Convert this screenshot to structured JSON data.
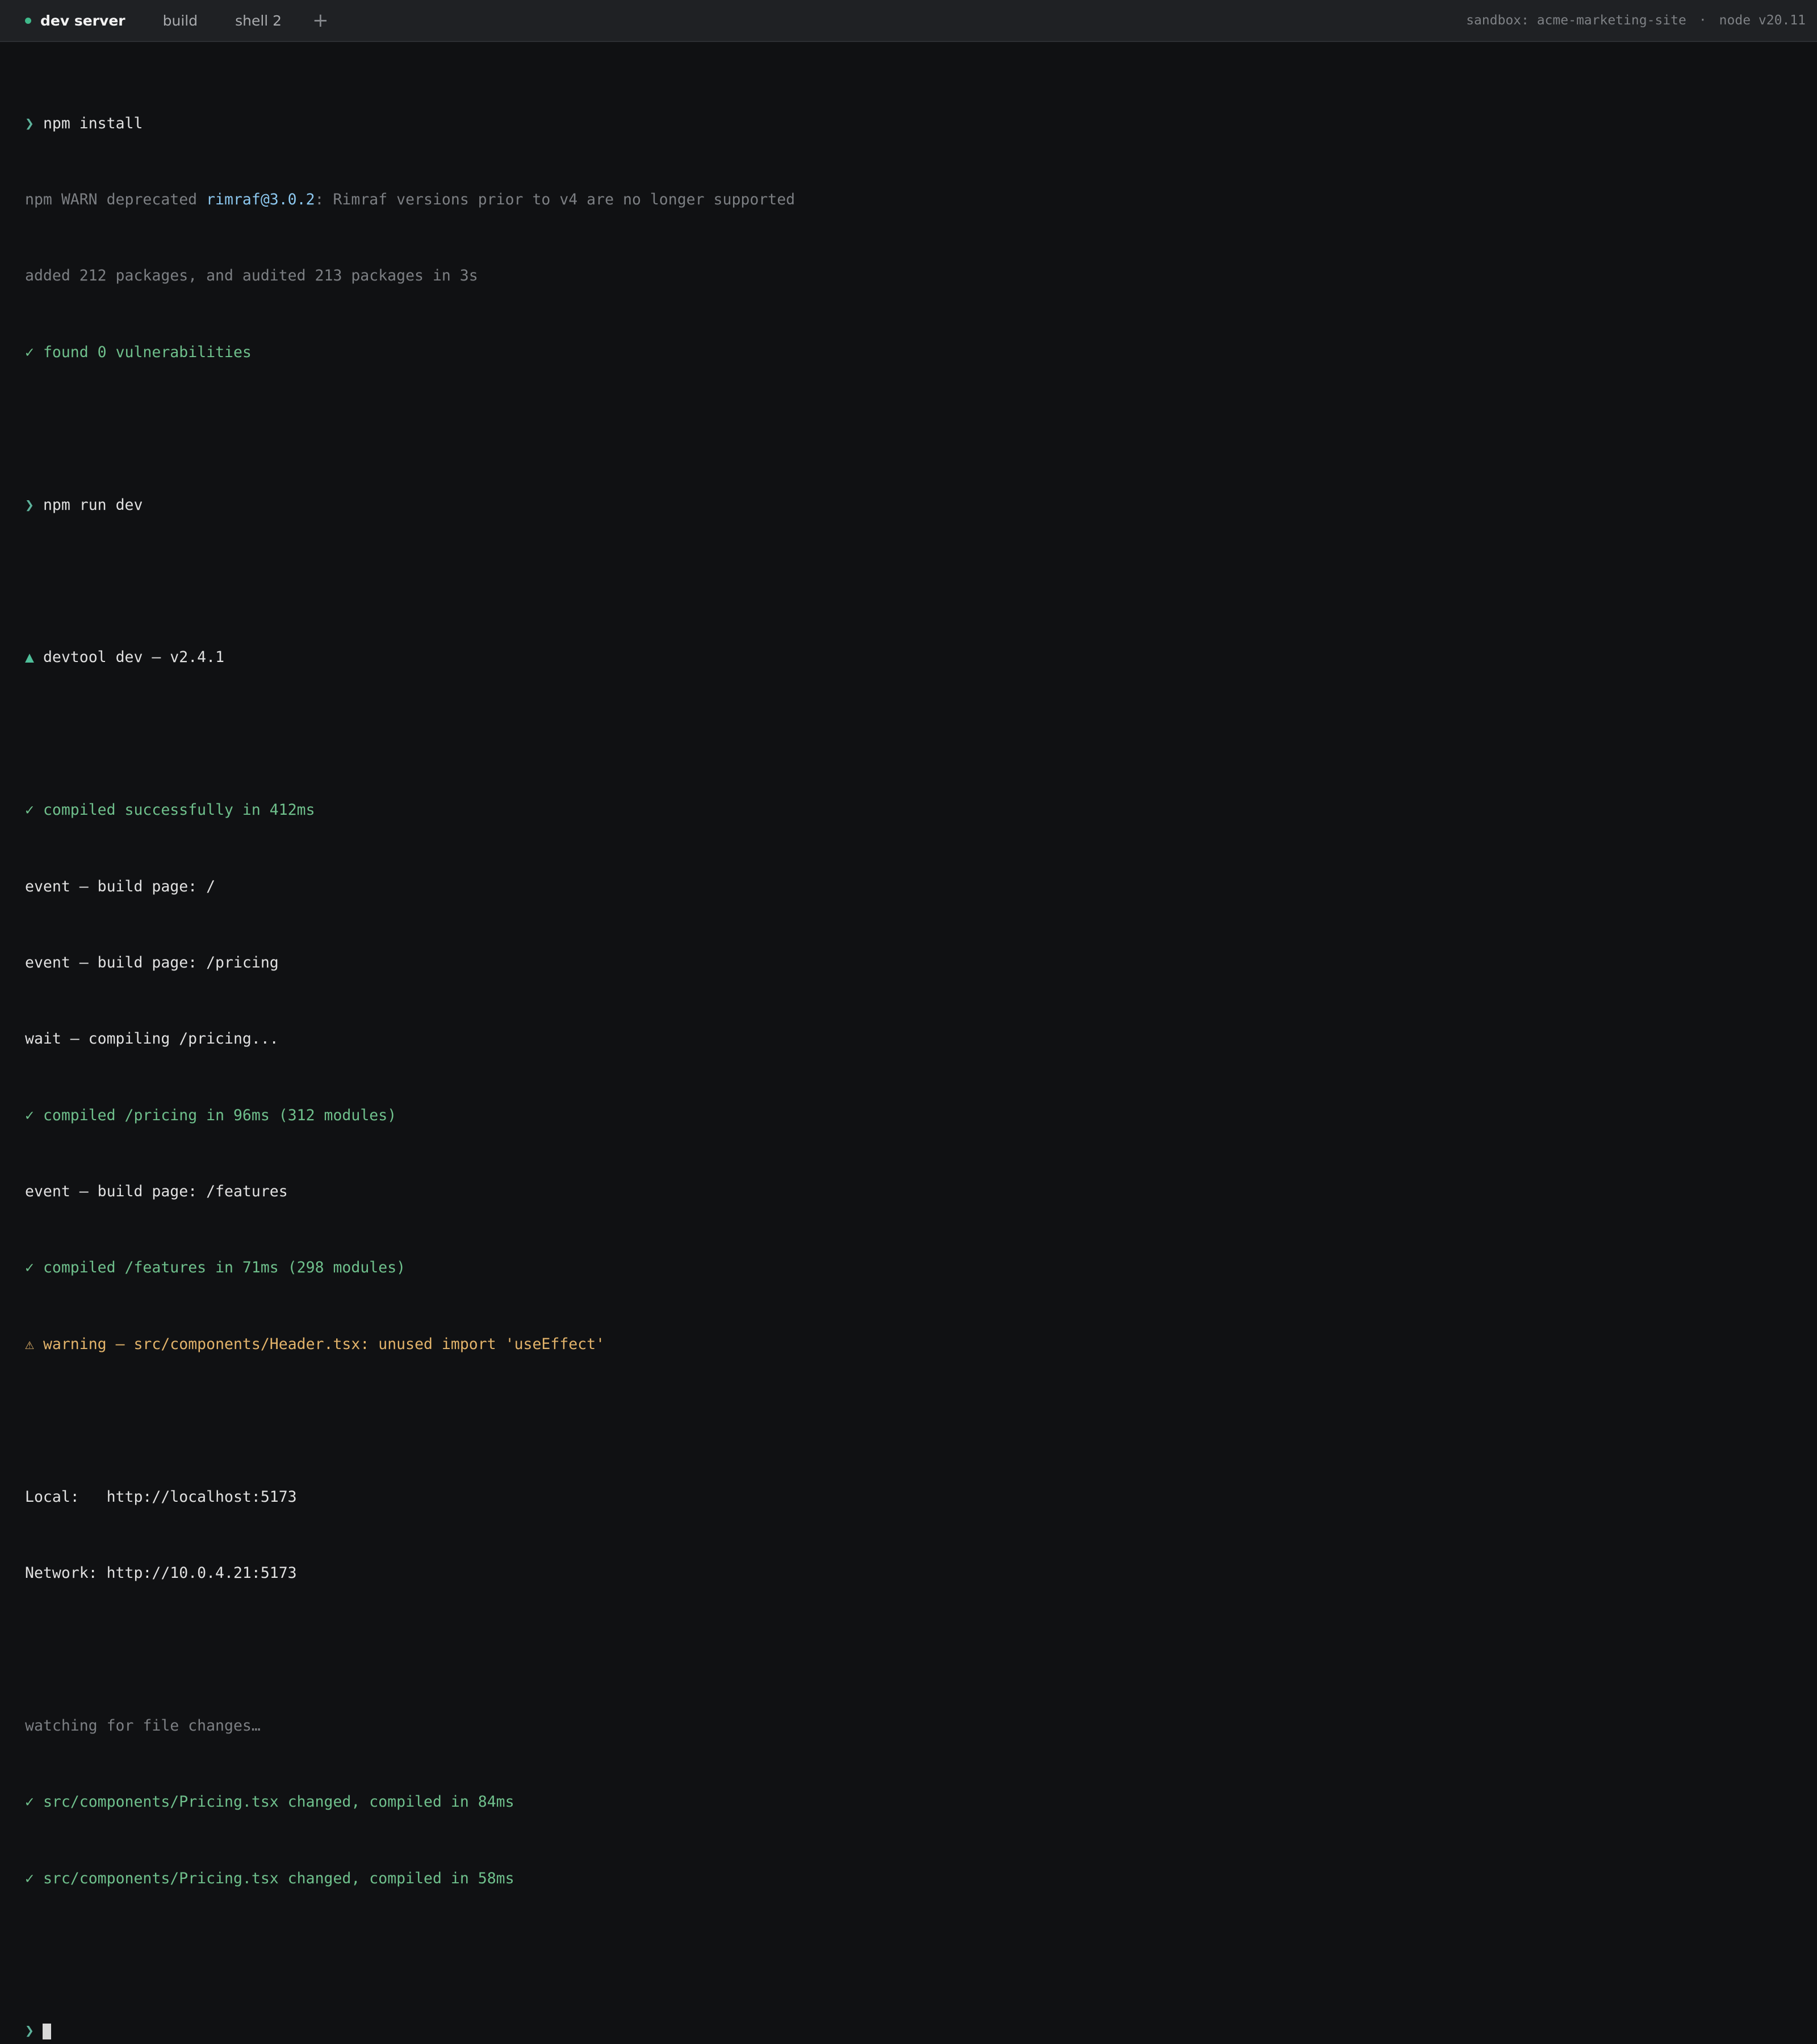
{
  "tabs": [
    {
      "label": "dev server",
      "active": true,
      "status": "running"
    },
    {
      "label": "build",
      "active": false
    },
    {
      "label": "shell 2",
      "active": false
    }
  ],
  "add_tab_label": "+",
  "meta": {
    "sandbox": "sandbox: acme-marketing-site",
    "separator": "·",
    "node": "node v20.11"
  },
  "terminal": {
    "prompt_symbol": "❯",
    "check_symbol": "✓",
    "warn_symbol": "⚠",
    "triangle_symbol": "▲",
    "cmd1": "npm install",
    "warn_prefix": "npm WARN deprecated ",
    "warn_pkg": "rimraf@3.0.2",
    "warn_rest": ": Rimraf versions prior to v4 are no longer supported",
    "added": "added 212 packages, and audited 213 packages in 3s",
    "vulns": "found 0 vulnerabilities",
    "cmd2": "npm run dev",
    "devtool": "devtool dev — v2.4.1",
    "compiled": "compiled successfully in 412ms",
    "event1": "event — build page: /",
    "event2": "event — build page: /pricing",
    "wait": "wait — compiling /pricing...",
    "compiled_pricing": "compiled /pricing in 96ms (312 modules)",
    "event3": "event — build page: /features",
    "compiled_features": "compiled /features in 71ms (298 modules)",
    "warning": "warning — src/components/Header.tsx: unused import 'useEffect'",
    "local": "Local:   http://localhost:5173",
    "network": "Network: http://10.0.4.21:5173",
    "watching": "watching for file changes…",
    "changed1": "src/components/Pricing.tsx changed, compiled in 84ms",
    "changed2": "src/components/Pricing.tsx changed, compiled in 58ms"
  },
  "colors": {
    "background": "#101113",
    "tabbar": "#1f2124",
    "prompt": "#5db29b",
    "success": "#6fc08c",
    "warning": "#e2b36a",
    "muted": "#7c7f83",
    "package": "#8cc7ee"
  }
}
